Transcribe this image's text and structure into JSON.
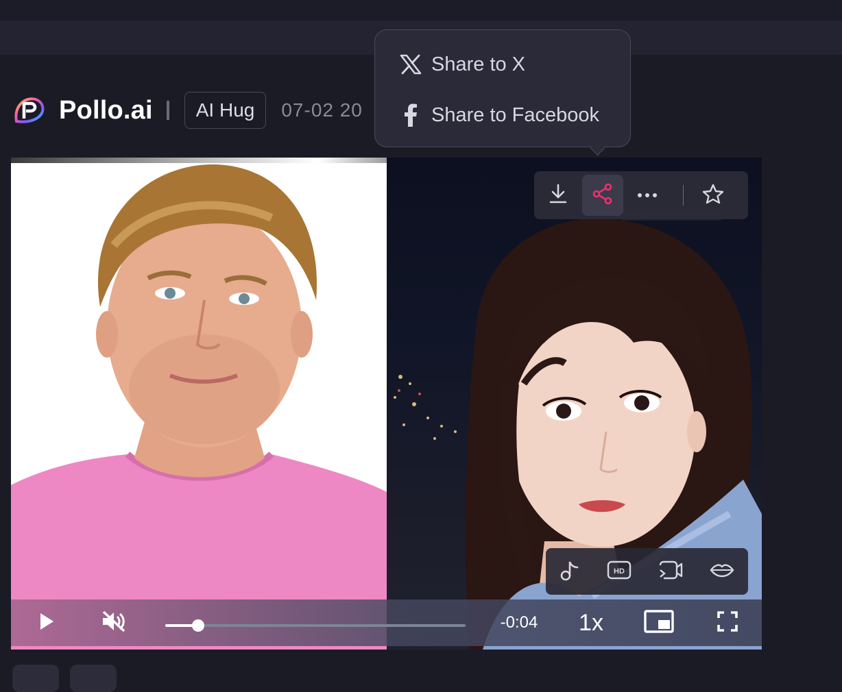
{
  "header": {
    "brand": "Pollo.ai",
    "tag": "AI Hug",
    "date": "07-02 20"
  },
  "share_menu": {
    "items": [
      {
        "label": "Share to X",
        "icon": "x-logo-icon"
      },
      {
        "label": "Share to Facebook",
        "icon": "facebook-icon"
      }
    ]
  },
  "video_toolbar": {
    "buttons": [
      "download-icon",
      "share-icon",
      "more-icon",
      "star-icon"
    ],
    "accent": "#f0306a"
  },
  "video_tools": {
    "buttons": [
      "music-note-icon",
      "hd-icon",
      "video-call-icon",
      "lips-icon"
    ]
  },
  "player": {
    "time_remaining": "-0:04",
    "playback_rate": "1x",
    "progress": 0.11,
    "muted": true
  }
}
